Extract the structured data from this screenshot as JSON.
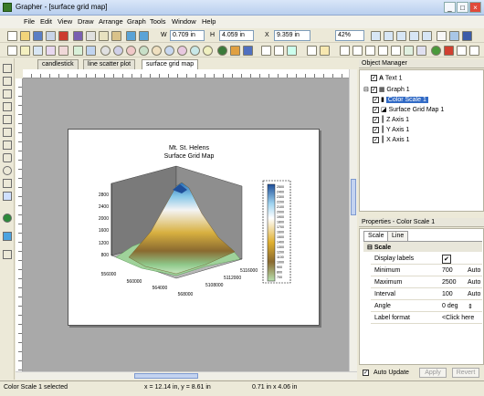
{
  "window": {
    "title": "Grapher - [surface grid map]"
  },
  "menu": [
    "File",
    "Edit",
    "View",
    "Draw",
    "Arrange",
    "Graph",
    "Tools",
    "Window",
    "Help"
  ],
  "toolbar": {
    "w_label": "W",
    "w_value": "0.709 in",
    "h_label": "H",
    "h_value": "4.059 in",
    "x_label": "X",
    "x_value": "9.359 in",
    "zoom": "42%"
  },
  "tabs": [
    "candlestick",
    "line scatter plot",
    "surface grid map"
  ],
  "plot": {
    "title": "Mt. St. Helens",
    "subtitle": "Surface Grid Map",
    "z_ticks": [
      "2800",
      "2400",
      "2000",
      "1600",
      "1200",
      "800"
    ],
    "x_ticks": [
      "556000",
      "560000",
      "564000",
      "568000"
    ],
    "y_ticks": [
      "5108000",
      "5112000",
      "5116000"
    ],
    "scale_labels": [
      "2500",
      "2400",
      "2300",
      "2200",
      "2100",
      "2000",
      "1900",
      "1800",
      "1700",
      "1600",
      "1500",
      "1400",
      "1300",
      "1200",
      "1100",
      "1000",
      "900",
      "800",
      "700"
    ]
  },
  "object_manager": {
    "title": "Object Manager",
    "items": [
      "Text 1",
      "Graph 1",
      "Color Scale 1",
      "Surface Grid Map 1",
      "Z Axis 1",
      "Y Axis 1",
      "X Axis 1"
    ]
  },
  "properties": {
    "title": "Properties - Color Scale 1",
    "tabs": [
      "Scale",
      "Line"
    ],
    "section": "Scale",
    "rows": [
      {
        "k": "Display labels",
        "v": "✔",
        "u": ""
      },
      {
        "k": "Minimum",
        "v": "700",
        "u": "Auto"
      },
      {
        "k": "Maximum",
        "v": "2500",
        "u": "Auto"
      },
      {
        "k": "Interval",
        "v": "100",
        "u": "Auto"
      },
      {
        "k": "Angle",
        "v": "0 deg",
        "u": "⇕"
      },
      {
        "k": "Label format",
        "v": "<Click here",
        "u": ""
      }
    ],
    "auto_update": "Auto Update",
    "apply": "Apply",
    "revert": "Revert"
  },
  "status": {
    "selection": "Color Scale 1 selected",
    "coords": "x = 12.14 in, y = 8.61 in",
    "size": "0.71 in x 4.06 in"
  }
}
